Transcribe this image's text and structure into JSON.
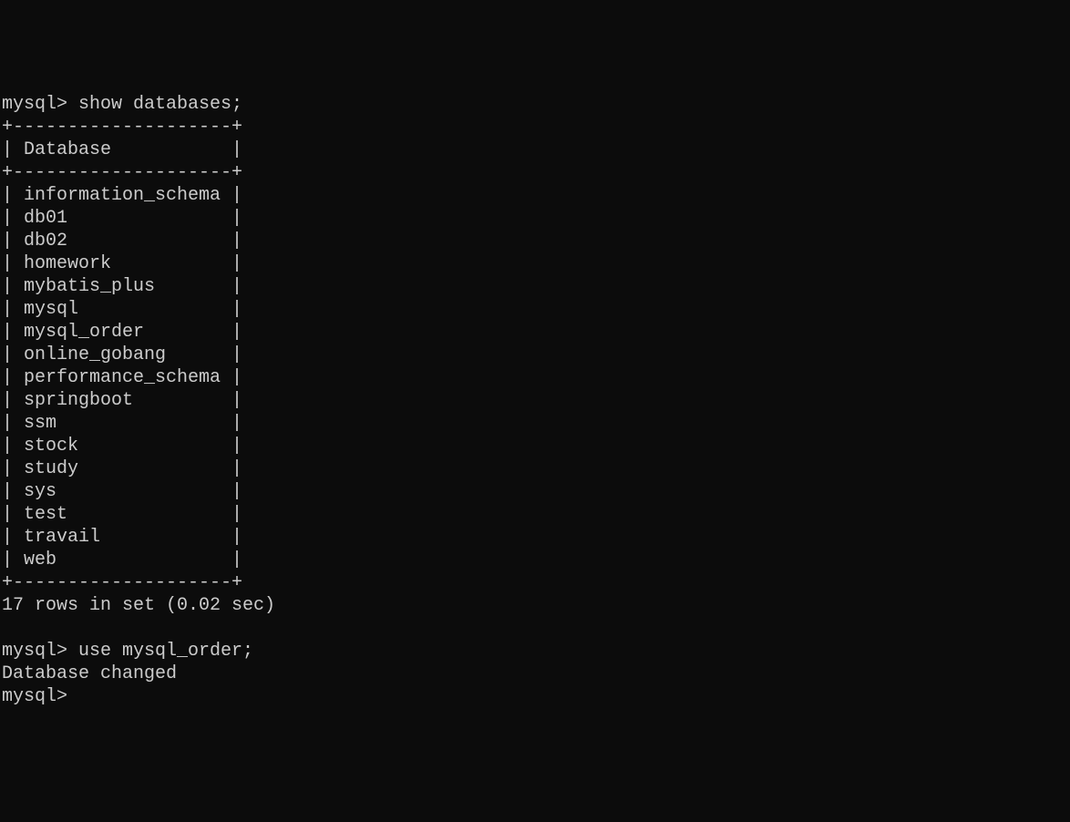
{
  "prompt": "mysql>",
  "command1": "show databases;",
  "border_top": "+--------------------+",
  "header_label": "Database",
  "databases": [
    "information_schema",
    "db01",
    "db02",
    "homework",
    "mybatis_plus",
    "mysql",
    "mysql_order",
    "online_gobang",
    "performance_schema",
    "springboot",
    "ssm",
    "stock",
    "study",
    "sys",
    "test",
    "travail",
    "web"
  ],
  "result_summary": "17 rows in set (0.02 sec)",
  "command2": "use mysql_order;",
  "response2": "Database changed",
  "col_inner_width": 20
}
